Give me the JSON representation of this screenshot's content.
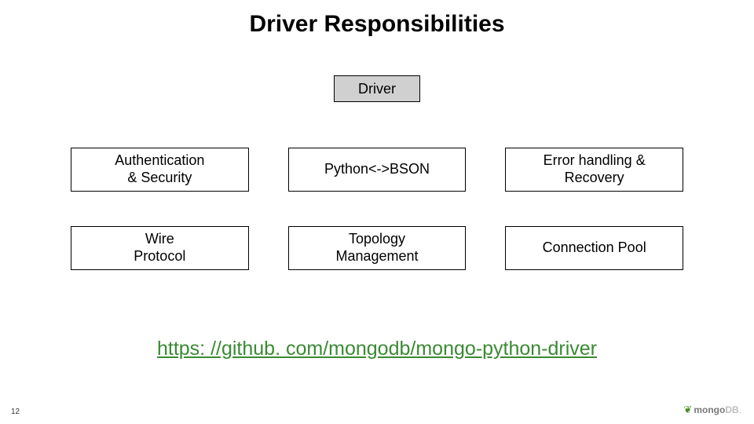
{
  "title": "Driver Responsibilities",
  "driver_label": "Driver",
  "boxes": [
    "Authentication\n& Security",
    "Python<->BSON",
    "Error handling &\nRecovery",
    "Wire\nProtocol",
    "Topology\nManagement",
    "Connection Pool"
  ],
  "link_text": "https: //github. com/mongodb/mongo-python-driver",
  "page_number": "12",
  "logo": {
    "brand": "mongo",
    "suffix": "DB",
    "trailing": "."
  }
}
